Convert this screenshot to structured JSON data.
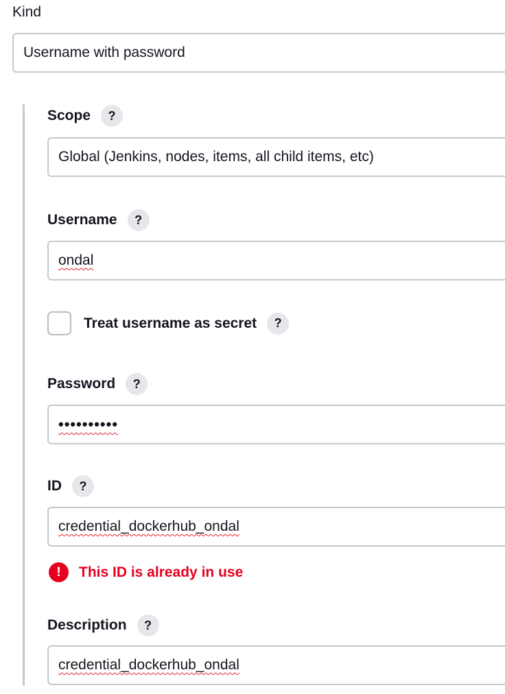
{
  "kind": {
    "label": "Kind",
    "value": "Username with password"
  },
  "scope": {
    "label": "Scope",
    "help": "?",
    "value": "Global (Jenkins, nodes, items, all child items, etc)"
  },
  "username": {
    "label": "Username",
    "help": "?",
    "value": "ondal"
  },
  "treat_secret": {
    "label": "Treat username as secret",
    "help": "?",
    "checked": false
  },
  "password": {
    "label": "Password",
    "help": "?",
    "value": "••••••••••"
  },
  "id": {
    "label": "ID",
    "help": "?",
    "value": "credential_dockerhub_ondal",
    "error_icon": "!",
    "error": "This ID is already in use"
  },
  "description": {
    "label": "Description",
    "help": "?",
    "value": "credential_dockerhub_ondal"
  },
  "colors": {
    "error": "#e6001f",
    "border": "#c4c8cd",
    "help_bg": "#e6e7ea"
  }
}
